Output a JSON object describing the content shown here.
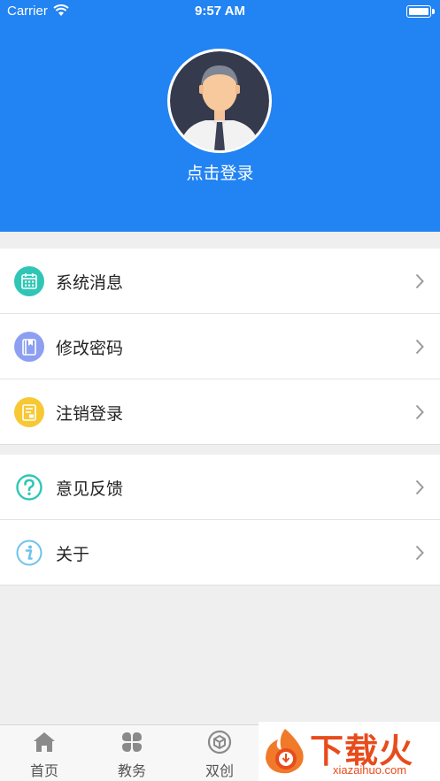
{
  "status_bar": {
    "carrier": "Carrier",
    "time": "9:57 AM"
  },
  "profile": {
    "login_label": "点击登录"
  },
  "menu_groups": [
    {
      "items": [
        {
          "label": "系统消息",
          "icon": "calendar-icon",
          "color": "#2fc6b5"
        },
        {
          "label": "修改密码",
          "icon": "book-icon",
          "color": "#8d9ff0"
        },
        {
          "label": "注销登录",
          "icon": "document-icon",
          "color": "#f7c834"
        }
      ]
    },
    {
      "items": [
        {
          "label": "意见反馈",
          "icon": "question-icon",
          "color": "#2fc6b5"
        },
        {
          "label": "关于",
          "icon": "info-icon",
          "color": "#6cc3ec"
        }
      ]
    }
  ],
  "tab_bar": {
    "tabs": [
      {
        "label": "首页",
        "icon": "home-icon"
      },
      {
        "label": "教务",
        "icon": "grid-petals-icon"
      },
      {
        "label": "双创",
        "icon": "cube-circle-icon"
      }
    ]
  },
  "watermark": {
    "title": "下载火",
    "url": "xiazaihuo.com"
  },
  "colors": {
    "header": "#2283f3",
    "background": "#efefef",
    "accent_orange": "#e84b1c"
  }
}
